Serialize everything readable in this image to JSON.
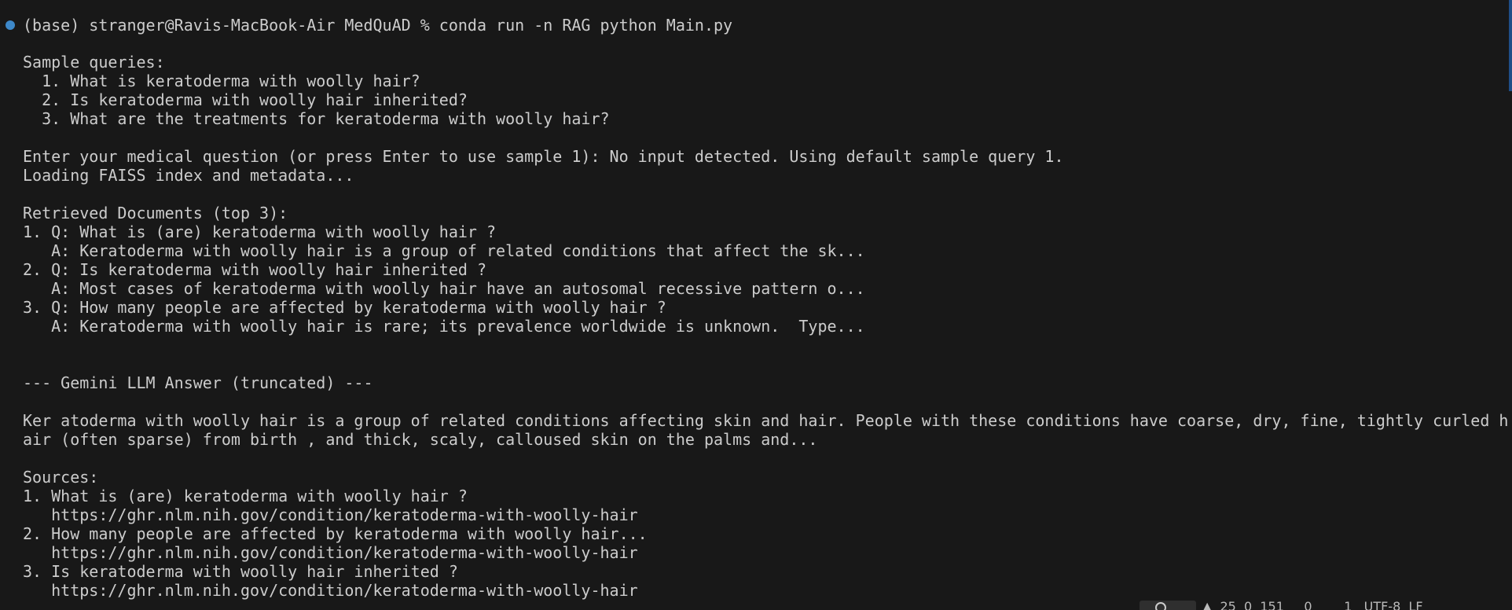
{
  "terminal": {
    "prompt": "(base) stranger@Ravis-MacBook-Air MedQuAD % conda run -n RAG python Main.py",
    "lines": [
      "Sample queries:",
      "  1. What is keratoderma with woolly hair?",
      "  2. Is keratoderma with woolly hair inherited?",
      "  3. What are the treatments for keratoderma with woolly hair?",
      "",
      "Enter your medical question (or press Enter to use sample 1): No input detected. Using default sample query 1.",
      "Loading FAISS index and metadata...",
      "",
      "Retrieved Documents (top 3):",
      "1. Q: What is (are) keratoderma with woolly hair ?",
      "   A: Keratoderma with woolly hair is a group of related conditions that affect the sk...",
      "2. Q: Is keratoderma with woolly hair inherited ?",
      "   A: Most cases of keratoderma with woolly hair have an autosomal recessive pattern o...",
      "3. Q: How many people are affected by keratoderma with woolly hair ?",
      "   A: Keratoderma with woolly hair is rare; its prevalence worldwide is unknown.  Type...",
      "",
      "",
      "--- Gemini LLM Answer (truncated) ---",
      "",
      "Ker atoderma with woolly hair is a group of related conditions affecting skin and hair. People with these conditions have coarse, dry, fine, tightly curled h",
      "air (often sparse) from birth , and thick, scaly, calloused skin on the palms and...",
      "",
      "Sources:",
      "1. What is (are) keratoderma with woolly hair ?",
      "   https://ghr.nlm.nih.gov/condition/keratoderma-with-woolly-hair",
      "2. How many people are affected by keratoderma with woolly hair...",
      "   https://ghr.nlm.nih.gov/condition/keratoderma-with-woolly-hair",
      "3. Is keratoderma with woolly hair inherited ?",
      "   https://ghr.nlm.nih.gov/condition/keratoderma-with-woolly-hair"
    ]
  },
  "status_bar": {
    "fragments": "▲  25  0  151     0        1   UTF-8  LF"
  },
  "colors": {
    "background": "#181818",
    "text": "#cccccc",
    "command_dot": "#3d88c9"
  }
}
